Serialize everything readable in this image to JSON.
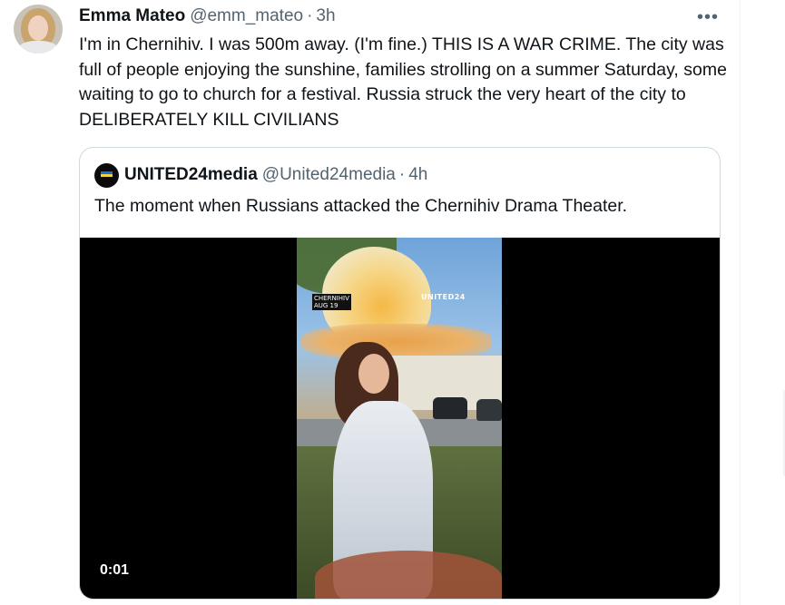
{
  "tweet": {
    "author_name": "Emma Mateo",
    "author_handle": "@emm_mateo",
    "separator": "·",
    "time": "3h",
    "more_icon": "•••",
    "text": "I'm in Chernihiv. I was 500m away. (I'm fine.) THIS IS A WAR CRIME. The city was full of people enjoying the sunshine, families strolling on a summer Saturday, some waiting to go to church for a festival. Russia struck the very heart of the city to DELIBERATELY KILL CIVILIANS"
  },
  "quote": {
    "author_name": "UNITED24media",
    "author_handle": "@United24media",
    "separator": "·",
    "time": "4h",
    "text": "The moment when Russians attacked the Chernihiv Drama Theater.",
    "video": {
      "location_tag": "CHERNIHIV\nAUG 19",
      "brand_watermark": "UNITED24",
      "elapsed": "0:01"
    }
  },
  "colors": {
    "text_primary": "#0f1419",
    "text_secondary": "#536471",
    "border": "#cfd9de",
    "video_background": "#000000"
  },
  "icons": {
    "more": "more-horizontal-icon",
    "avatar_quote": "united24-logo"
  }
}
